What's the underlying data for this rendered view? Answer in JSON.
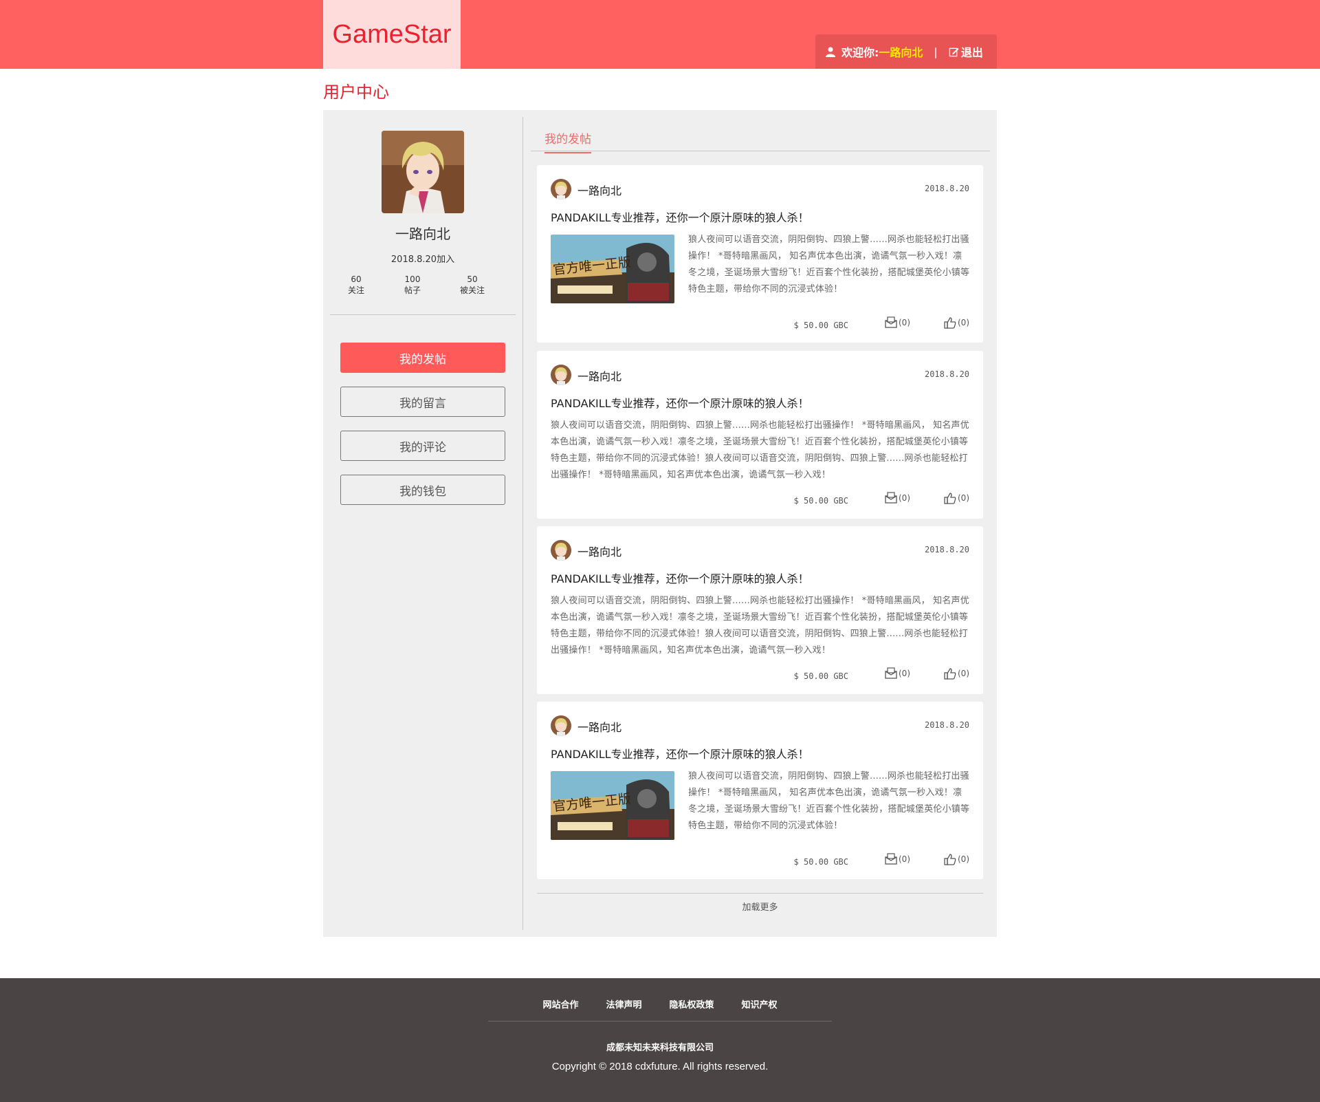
{
  "header": {
    "logo": "GameStar",
    "welcome_label": "欢迎你:",
    "username": "一路向北",
    "separator": "|",
    "logout": "退出"
  },
  "page_title": "用户中心",
  "profile": {
    "name": "一路向北",
    "joined": "2018.8.20加入",
    "stats": [
      {
        "value": "60",
        "label": "关注"
      },
      {
        "value": "100",
        "label": "帖子"
      },
      {
        "value": "50",
        "label": "被关注"
      }
    ]
  },
  "menu": [
    {
      "label": "我的发帖",
      "active": true
    },
    {
      "label": "我的留言",
      "active": false
    },
    {
      "label": "我的评论",
      "active": false
    },
    {
      "label": "我的钱包",
      "active": false
    }
  ],
  "tab": "我的发帖",
  "posts": [
    {
      "author": "一路向北",
      "date": "2018.8.20",
      "title": "PANDAKILL专业推荐，还你一个原汁原味的狼人杀！",
      "has_image": true,
      "image_caption": "官方唯一正版",
      "body": "狼人夜间可以语音交流，阴阳倒钩、四狼上警......网杀也能轻松打出骚操作！  *哥特暗黑画风， 知名声优本色出演，诡谲气氛一秒入戏！凛冬之境，圣诞场景大雪纷飞！近百套个性化装扮，搭配城堡英伦小镇等特色主题，带给你不同的沉浸式体验！",
      "price": "$ 50.00 GBC",
      "messages": "(0)",
      "likes": "(0)"
    },
    {
      "author": "一路向北",
      "date": "2018.8.20",
      "title": "PANDAKILL专业推荐，还你一个原汁原味的狼人杀！",
      "has_image": false,
      "body": "狼人夜间可以语音交流，阴阳倒钩、四狼上警......网杀也能轻松打出骚操作！  *哥特暗黑画风， 知名声优本色出演，诡谲气氛一秒入戏！凛冬之境，圣诞场景大雪纷飞！近百套个性化装扮，搭配城堡英伦小镇等特色主题，带给你不同的沉浸式体验！狼人夜间可以语音交流，阴阳倒钩、四狼上警......网杀也能轻松打出骚操作！  *哥特暗黑画风，知名声优本色出演，诡谲气氛一秒入戏！",
      "price": "$ 50.00 GBC",
      "messages": "(0)",
      "likes": "(0)"
    },
    {
      "author": "一路向北",
      "date": "2018.8.20",
      "title": "PANDAKILL专业推荐，还你一个原汁原味的狼人杀！",
      "has_image": false,
      "body": "狼人夜间可以语音交流，阴阳倒钩、四狼上警......网杀也能轻松打出骚操作！  *哥特暗黑画风， 知名声优本色出演，诡谲气氛一秒入戏！凛冬之境，圣诞场景大雪纷飞！近百套个性化装扮，搭配城堡英伦小镇等特色主题，带给你不同的沉浸式体验！狼人夜间可以语音交流，阴阳倒钩、四狼上警......网杀也能轻松打出骚操作！  *哥特暗黑画风，知名声优本色出演，诡谲气氛一秒入戏！",
      "price": "$ 50.00 GBC",
      "messages": "(0)",
      "likes": "(0)"
    },
    {
      "author": "一路向北",
      "date": "2018.8.20",
      "title": "PANDAKILL专业推荐，还你一个原汁原味的狼人杀！",
      "has_image": true,
      "image_caption": "官方唯一正版",
      "body": "狼人夜间可以语音交流，阴阳倒钩、四狼上警......网杀也能轻松打出骚操作！  *哥特暗黑画风， 知名声优本色出演，诡谲气氛一秒入戏！凛冬之境，圣诞场景大雪纷飞！近百套个性化装扮，搭配城堡英伦小镇等特色主题，带给你不同的沉浸式体验！",
      "price": "$ 50.00 GBC",
      "messages": "(0)",
      "likes": "(0)"
    }
  ],
  "load_more": "加载更多",
  "footer": {
    "links": [
      "网站合作",
      "法律声明",
      "隐私权政策",
      "知识产权"
    ],
    "company": "成都未知未来科技有限公司",
    "copyright": "Copyright © 2018 cdxfuture. All rights reserved."
  },
  "colors": {
    "brand": "#ff6060",
    "accent": "#e8222e",
    "footer": "#4a4544"
  }
}
